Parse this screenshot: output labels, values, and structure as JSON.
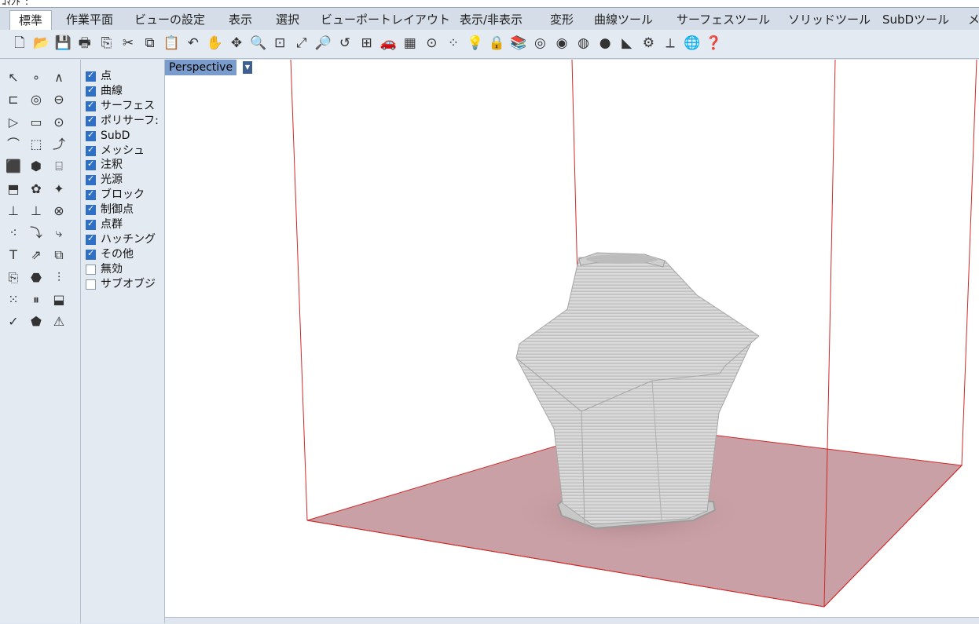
{
  "command_line": {
    "text": "ｺﾏﾝﾄﾞ:"
  },
  "menu_tabs": [
    "標準",
    "作業平面",
    "ビューの設定",
    "表示",
    "選択",
    "ビューポートレイアウト",
    "表示/非表示",
    "変形",
    "曲線ツール",
    "サーフェスツール",
    "ソリッドツール",
    "SubDツール",
    "メ"
  ],
  "toolbar_icons": [
    {
      "name": "new-file-icon",
      "glyph": "🗋"
    },
    {
      "name": "open-folder-icon",
      "glyph": "📂"
    },
    {
      "name": "save-icon",
      "glyph": "💾"
    },
    {
      "name": "print-icon",
      "glyph": "🖶"
    },
    {
      "name": "import-icon",
      "glyph": "⎘"
    },
    {
      "name": "cut-icon",
      "glyph": "✂"
    },
    {
      "name": "copy-icon",
      "glyph": "⧉"
    },
    {
      "name": "paste-icon",
      "glyph": "📋"
    },
    {
      "name": "undo-icon",
      "glyph": "↶"
    },
    {
      "name": "pan-hand-icon",
      "glyph": "✋"
    },
    {
      "name": "rotate-view-icon",
      "glyph": "✥"
    },
    {
      "name": "zoom-icon",
      "glyph": "🔍"
    },
    {
      "name": "zoom-window-icon",
      "glyph": "⊡"
    },
    {
      "name": "zoom-extents-icon",
      "glyph": "⤢"
    },
    {
      "name": "zoom-selected-icon",
      "glyph": "🔎"
    },
    {
      "name": "undo-view-icon",
      "glyph": "↺"
    },
    {
      "name": "four-viewports-icon",
      "glyph": "⊞"
    },
    {
      "name": "car-icon",
      "glyph": "🚗"
    },
    {
      "name": "grid-snap-icon",
      "glyph": "▦"
    },
    {
      "name": "osnap-icon",
      "glyph": "⊙"
    },
    {
      "name": "select-points-icon",
      "glyph": "⁘"
    },
    {
      "name": "light-bulb-icon",
      "glyph": "💡"
    },
    {
      "name": "lock-icon",
      "glyph": "🔒"
    },
    {
      "name": "layer-icon",
      "glyph": "📚"
    },
    {
      "name": "color-wheel-icon",
      "glyph": "◎"
    },
    {
      "name": "shaded-sphere-icon",
      "glyph": "◉"
    },
    {
      "name": "rendered-sphere-icon",
      "glyph": "◍"
    },
    {
      "name": "render-sphere-icon",
      "glyph": "●"
    },
    {
      "name": "cone-light-icon",
      "glyph": "◣"
    },
    {
      "name": "options-gear-icon",
      "glyph": "⚙"
    },
    {
      "name": "dimension-icon",
      "glyph": "⟂"
    },
    {
      "name": "globe-icon",
      "glyph": "🌐"
    },
    {
      "name": "help-icon",
      "glyph": "❓"
    }
  ],
  "left_tools": [
    "↖",
    "∘",
    "∧",
    "⊏",
    "◎",
    "⊖",
    "▷",
    "▭",
    "⊙",
    "⌒",
    "⬚",
    "⤴",
    "⬛",
    "⬢",
    "⌸",
    "⬒",
    "✿",
    "✦",
    "⊥",
    "⊥",
    "⊗",
    "⁖",
    "⤵",
    "⤷",
    "T",
    "⇗",
    "⧉",
    "⎘",
    "⬣",
    "⫶",
    "⁙",
    "⏸",
    "⬓",
    "✓",
    "⬟",
    "⚠"
  ],
  "filter_items": [
    {
      "label": "点",
      "checked": true
    },
    {
      "label": "曲線",
      "checked": true
    },
    {
      "label": "サーフェス",
      "checked": true
    },
    {
      "label": "ポリサーフ:",
      "checked": true
    },
    {
      "label": "SubD",
      "checked": true
    },
    {
      "label": "メッシュ",
      "checked": true
    },
    {
      "label": "注釈",
      "checked": true
    },
    {
      "label": "光源",
      "checked": true
    },
    {
      "label": "ブロック",
      "checked": true
    },
    {
      "label": "制御点",
      "checked": true
    },
    {
      "label": "点群",
      "checked": true
    },
    {
      "label": "ハッチング",
      "checked": true
    },
    {
      "label": "その他",
      "checked": true
    },
    {
      "label": "無効",
      "checked": false
    },
    {
      "label": "サブオブジ",
      "checked": false
    }
  ],
  "viewport": {
    "title": "Perspective",
    "dropdown_glyph": "▼"
  },
  "colors": {
    "ground": "#c9a0a5",
    "bounding_box": "#d02828",
    "vase": "#d8d8d8"
  }
}
